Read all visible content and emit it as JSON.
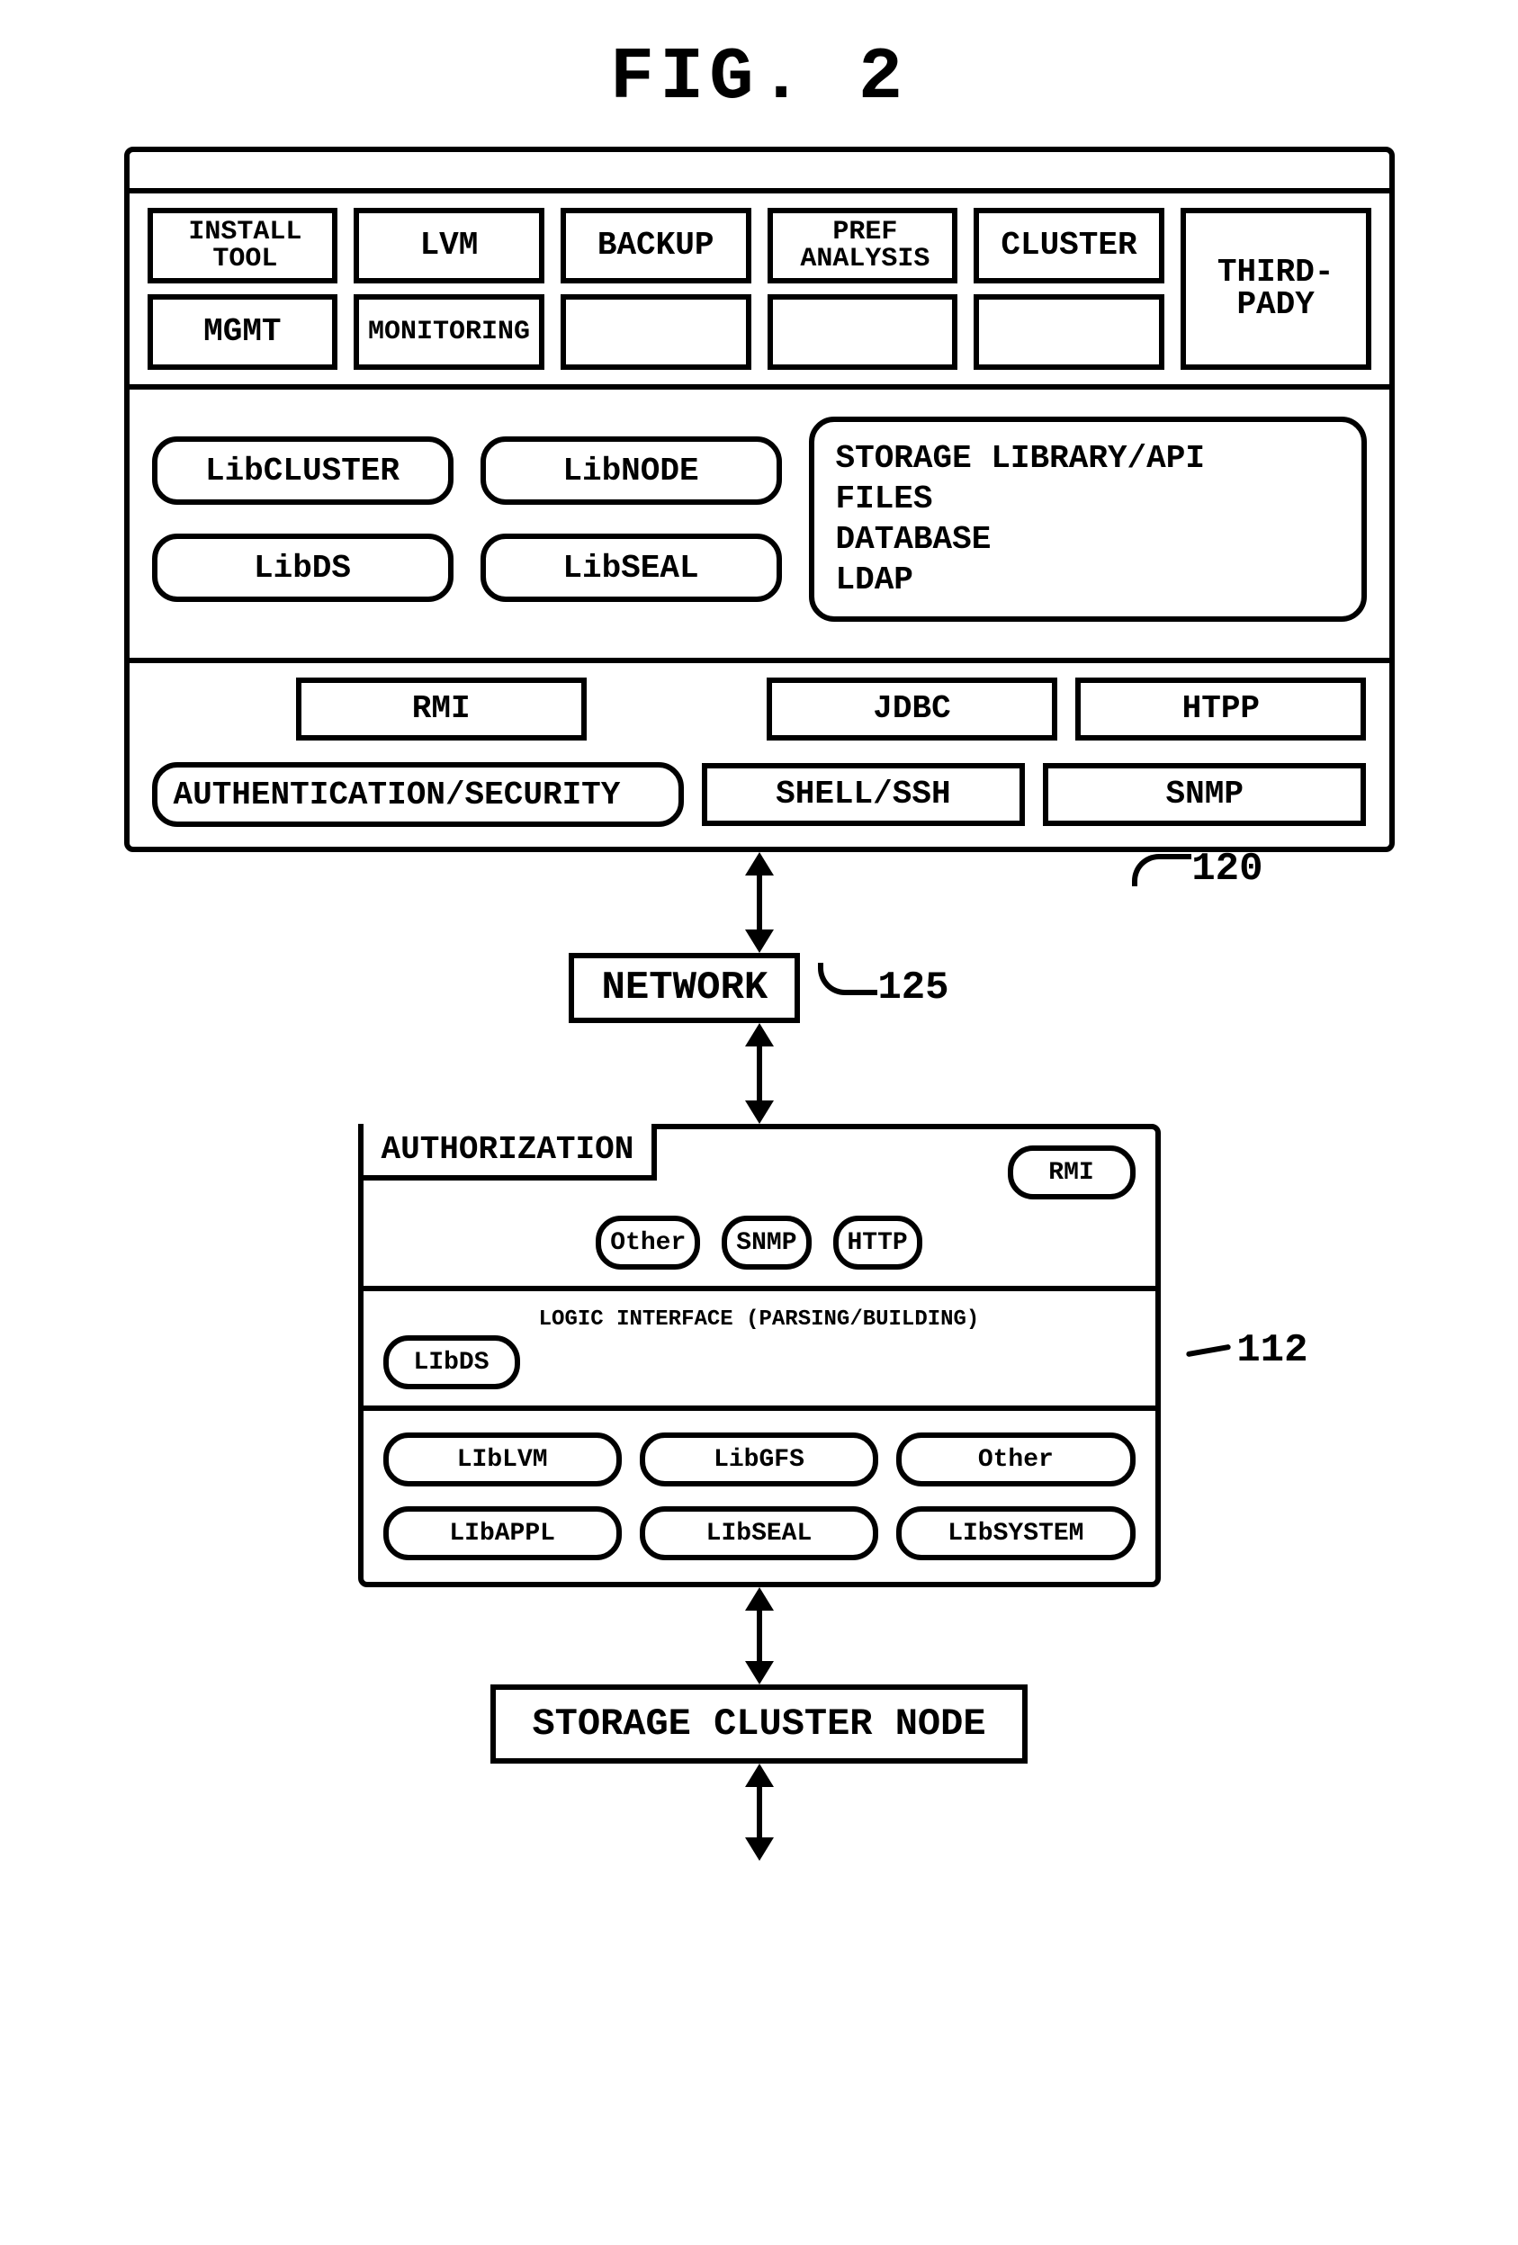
{
  "title": "FIG. 2",
  "labels": {
    "l120": "120",
    "l125": "125",
    "l112": "112"
  },
  "top": {
    "row1": [
      "INSTALL TOOL",
      "LVM",
      "BACKUP",
      "PREF ANALYSIS",
      "CLUSTER"
    ],
    "third_party": "THIRD-PADY",
    "row2": [
      "MGMT",
      "MONITORING",
      "",
      "",
      ""
    ],
    "libs": [
      "LibCLUSTER",
      "LibNODE",
      "LibDS",
      "LibSEAL"
    ],
    "storage_api": "STORAGE LIBRARY/API\nFILES\nDATABASE\nLDAP",
    "proto1": [
      "RMI",
      "JDBC",
      "HTPP"
    ],
    "auth_sec": "AUTHENTICATION/SECURITY",
    "proto2": [
      "SHELL/SSH",
      "SNMP"
    ]
  },
  "network": "NETWORK",
  "mid": {
    "authorization": "AUTHORIZATION",
    "auth_pills": [
      "RMI",
      "Other",
      "SNMP",
      "HTTP"
    ],
    "logic_label": "LOGIC INTERFACE (PARSING/BUILDING)",
    "logic_pill": "LIbDS",
    "libs": [
      "LIbLVM",
      "LibGFS",
      "Other",
      "LIbAPPL",
      "LIbSEAL",
      "LIbSYSTEM"
    ]
  },
  "footer": "STORAGE CLUSTER NODE"
}
